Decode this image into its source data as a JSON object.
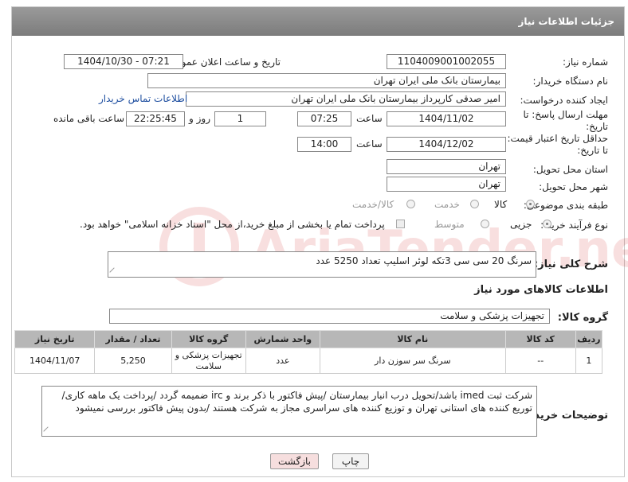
{
  "header": {
    "title": "جزئیات اطلاعات نیاز"
  },
  "form": {
    "need_number_label": "شماره نیاز:",
    "need_number": "1104009001002055",
    "announce_label": "تاریخ و ساعت اعلان عمومی:",
    "announce_value": "1404/10/30 - 07:21",
    "buyer_org_label": "نام دستگاه خریدار:",
    "buyer_org": "بیمارستان بانک ملی ایران تهران",
    "creator_label": "ایجاد کننده درخواست:",
    "creator": "امیر صدقی کارپرداز بیمارستان بانک ملی ایران تهران",
    "contact_link": "اطلاعات تماس خریدار",
    "deadline_label_1": "مهلت ارسال پاسخ: تا",
    "deadline_label_2": "تاریخ:",
    "deadline_date": "1404/11/02",
    "time_label": "ساعت",
    "deadline_time": "07:25",
    "days_value": "1",
    "days_label": "روز و",
    "remaining_time": "22:25:45",
    "remaining_label": "ساعت باقی مانده",
    "validity_label_1": "حداقل تاریخ اعتبار قیمت:",
    "validity_label_2": "تا تاریخ:",
    "validity_date": "1404/12/02",
    "validity_time": "14:00",
    "province_label": "استان محل تحویل:",
    "province": "تهران",
    "city_label": "شهر محل تحویل:",
    "city": "تهران",
    "category_label": "طبقه بندی موضوعی:",
    "category_options": [
      "کالا",
      "خدمت",
      "کالا/خدمت"
    ],
    "process_label": "نوع فرآیند خرید :",
    "process_options": [
      "جزیی",
      "متوسط"
    ],
    "payment_note": "پرداخت تمام یا بخشی از مبلغ خرید،از محل \"اسناد خزانه اسلامی\" خواهد بود."
  },
  "description": {
    "label": "شرح کلی نیاز:",
    "value": "سرنگ 20 سی سی 3تکه لوئر اسلیپ تعداد 5250 عدد"
  },
  "goods": {
    "section_title": "اطلاعات کالاهای مورد نیاز",
    "group_label": "گروه کالا:",
    "group_value": "تجهیزات پزشکی و سلامت",
    "columns": [
      "ردیف",
      "کد کالا",
      "نام کالا",
      "واحد شمارش",
      "گروه کالا",
      "تعداد / مقدار",
      "تاریخ نیاز"
    ],
    "rows": [
      [
        "1",
        "--",
        "سرنگ سر سوزن دار",
        "عدد",
        "تجهیزات پزشکی و سلامت",
        "5,250",
        "1404/11/07"
      ]
    ]
  },
  "buyer_notes": {
    "label": "توضیحات خریدار:",
    "value": "شرکت ثبت imed باشد/تحویل درب انبار بیمارستان /پیش فاکتور با ذکر برند و irc ضمیمه گردد /پرداخت یک ماهه کاری/ توریع کننده های استانی تهران و توزیع کننده های سراسری مجاز به شرکت هستند /بدون پیش فاکتور بررسی نمیشود"
  },
  "buttons": {
    "print": "چاپ",
    "back": "بازگشت"
  },
  "watermark": {
    "text": "AriaTender.neT"
  },
  "colors": {
    "header": "#8a8a8a",
    "link": "#1f4fa0",
    "back_button": "#f6dede",
    "table_header": "#b7b7b7"
  }
}
